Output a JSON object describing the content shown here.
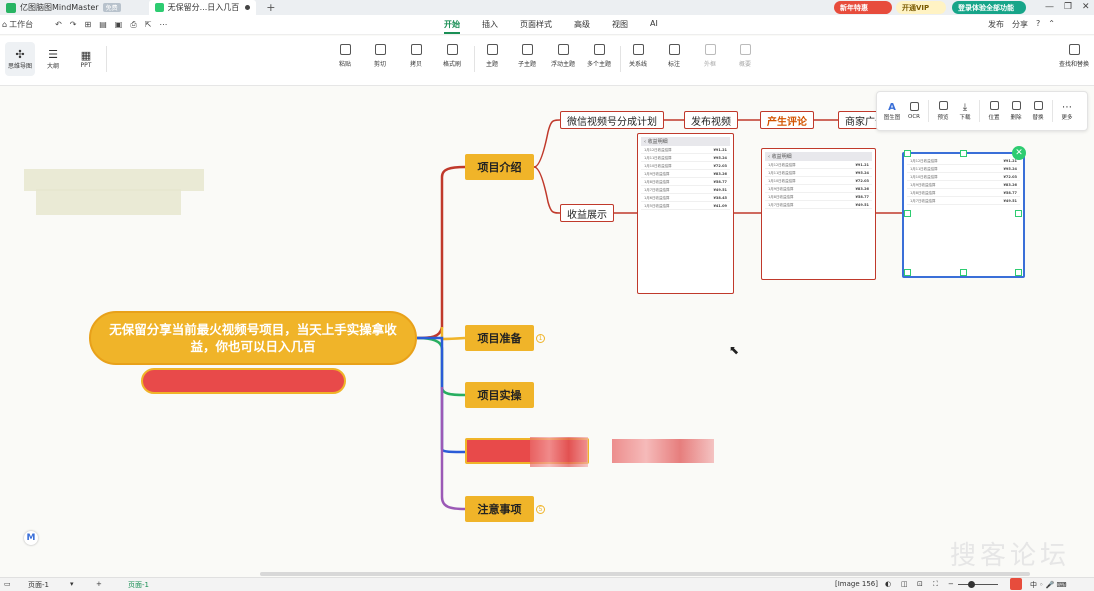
{
  "titlebar": {
    "app_tab": "亿图脑图MindMaster",
    "app_badge": "免费",
    "doc_tab": "无保留分...日入几百",
    "promo_new_year": "新年特惠",
    "promo_vip": "开通VIP",
    "promo_login": "登录体验全部功能"
  },
  "menubar": {
    "workspace": "工作台",
    "tabs": [
      "开始",
      "插入",
      "页面样式",
      "高级",
      "视图",
      "AI"
    ],
    "active_tab": "开始",
    "publish": "发布",
    "share": "分享"
  },
  "toolbar": {
    "views": [
      "思维导图",
      "大纲",
      "PPT"
    ],
    "buttons": [
      "粘贴",
      "剪切",
      "拷贝",
      "格式刷",
      "主题",
      "子主题",
      "浮动主题",
      "多个主题",
      "关系线",
      "标注",
      "外框",
      "概要"
    ],
    "disabled": [
      "外框",
      "概要"
    ],
    "find_replace": "查找和替换"
  },
  "floating_toolbar": {
    "items": [
      "图生图",
      "OCR",
      "预览",
      "下载",
      "位置",
      "删除",
      "替换",
      "更多"
    ]
  },
  "mindmap": {
    "central": "无保留分享当前最火视频号项目，当天上手实操拿收益，你也可以日入几百",
    "topics": [
      "项目介绍",
      "项目准备",
      "项目实操",
      "注意事项"
    ],
    "badge_prep": "1",
    "badge_notes": "5",
    "subtopics_intro": [
      "微信视频号分成计划",
      "收益展示"
    ],
    "chain": [
      "发布视频",
      "产生评论",
      "商家广告"
    ],
    "phone_header": "收益明细",
    "phone_rows": [
      {
        "title": "1月12日收益结算",
        "amount": "¥91.21"
      },
      {
        "title": "1月11日收益结算",
        "amount": "¥95.24"
      },
      {
        "title": "1月10日收益结算",
        "amount": "¥72.03"
      },
      {
        "title": "1月9日收益结算",
        "amount": "¥83.26"
      },
      {
        "title": "1月8日收益结算",
        "amount": "¥58.77"
      },
      {
        "title": "1月7日收益结算",
        "amount": "¥49.51"
      },
      {
        "title": "1月6日收益结算",
        "amount": "¥38.45"
      },
      {
        "title": "1月5日收益结算",
        "amount": "¥41.09"
      }
    ]
  },
  "statusbar": {
    "page_select": "页面-1",
    "page_tab": "页面-1",
    "image_count": "[Image 156]"
  },
  "watermark": "搜客论坛",
  "colors": {
    "accent_green": "#1a8f55",
    "topic_yellow": "#f0b429",
    "branch_red": "#c0392b",
    "branch_blue": "#2a5bd7",
    "branch_green": "#27ae60",
    "branch_purple": "#9b59b6"
  }
}
